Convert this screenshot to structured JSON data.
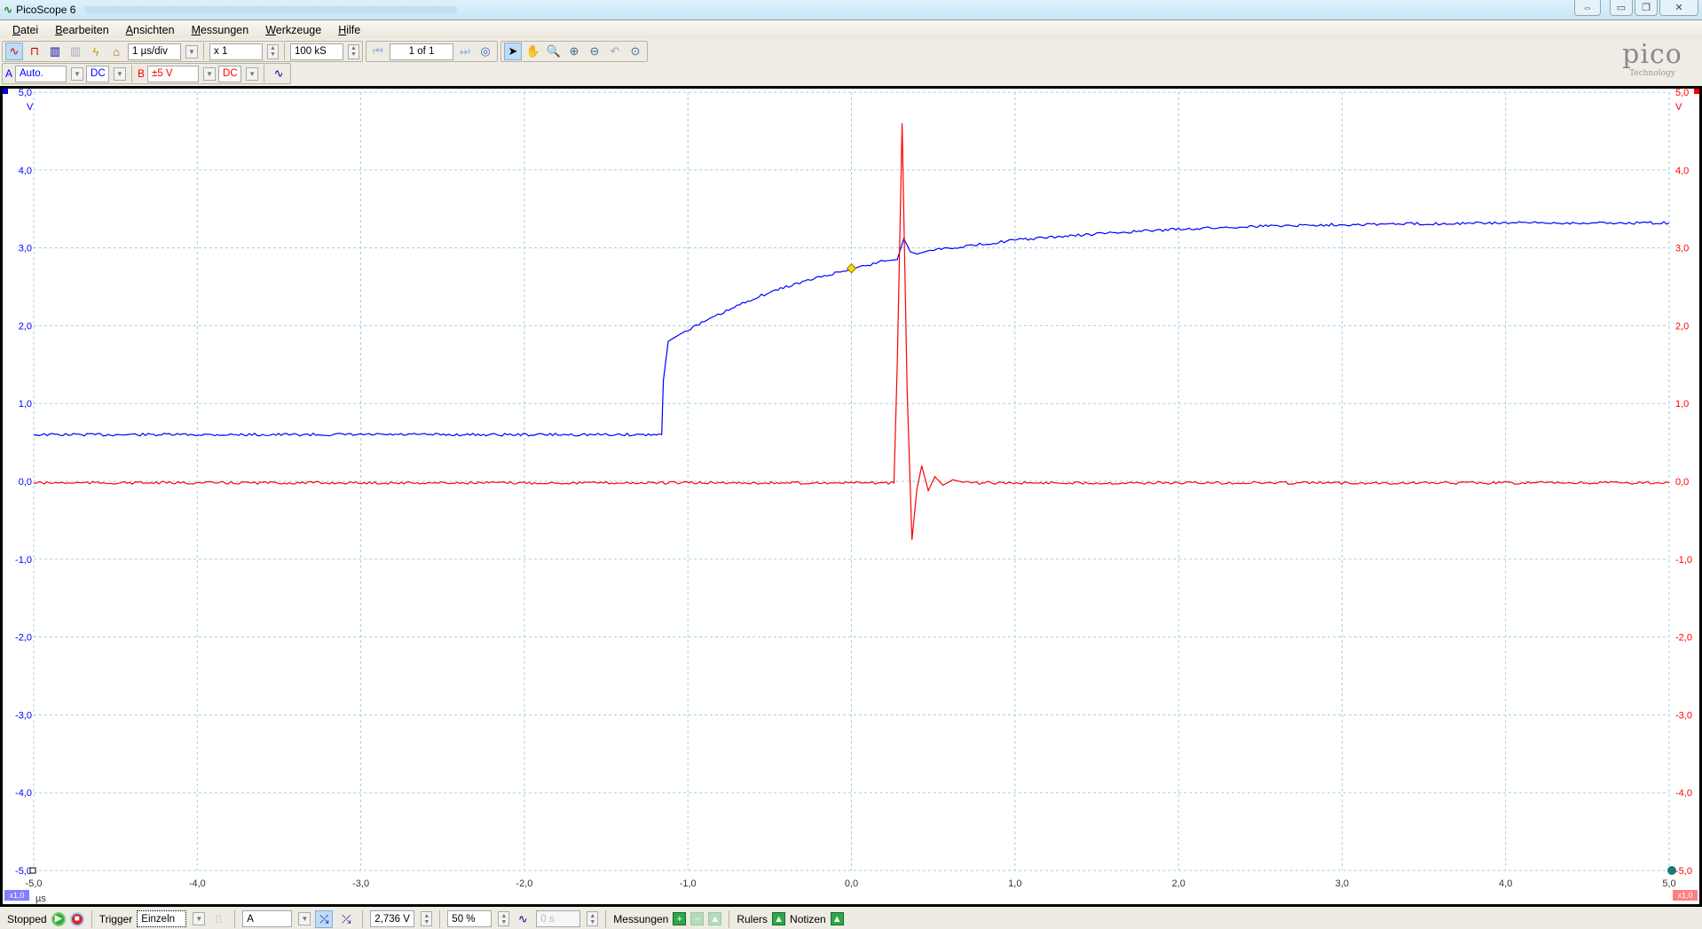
{
  "window": {
    "title": "PicoScope 6",
    "buttons": [
      "⇔",
      "▭",
      "❐",
      "✕"
    ]
  },
  "menu": [
    "Datei",
    "Bearbeiten",
    "Ansichten",
    "Messungen",
    "Werkzeuge",
    "Hilfe"
  ],
  "toolbar": {
    "timebase": "1 µs/div",
    "zoom_factor": "x 1",
    "samples": "100 kS",
    "buffer": "1 of 1"
  },
  "channels": {
    "a_label": "A",
    "a_range": "Auto.",
    "a_coupling": "DC",
    "b_label": "B",
    "b_range": "±5 V",
    "b_coupling": "DC"
  },
  "logo": {
    "name": "pico",
    "sub": "Technology"
  },
  "status": {
    "state": "Stopped",
    "trigger_label": "Trigger",
    "trigger_mode": "Einzeln",
    "trigger_source": "A",
    "threshold": "2,736 V",
    "pretrigger": "50 %",
    "delay": "0 s",
    "measurements": "Messungen",
    "rulers": "Rulers",
    "notes": "Notizen"
  },
  "chart_data": {
    "type": "line",
    "xlabel": "µs",
    "ylabel_left": "V",
    "ylabel_right": "V",
    "xlim": [
      -5,
      5
    ],
    "ylim": [
      -5,
      5
    ],
    "x_ticks": [
      "-5,0",
      "-4,0",
      "-3,0",
      "-2,0",
      "-1,0",
      "0,0",
      "1,0",
      "2,0",
      "3,0",
      "4,0",
      "5,0"
    ],
    "y_ticks": [
      "5,0",
      "4,0",
      "3,0",
      "2,0",
      "1,0",
      "0,0",
      "-1,0",
      "-2,0",
      "-3,0",
      "-4,0",
      "-5,0"
    ],
    "scale_badge_a": "x1,0",
    "scale_badge_b": "x1,0",
    "grid": true,
    "trigger_point": {
      "x": 0,
      "y": 2.736
    },
    "series": [
      {
        "name": "A",
        "color": "#0000ff",
        "x": [
          -5,
          -1.16,
          -1.15,
          -1.12,
          -1.0,
          -0.8,
          -0.6,
          -0.4,
          -0.2,
          0.0,
          0.2,
          0.28,
          0.32,
          0.36,
          0.4,
          0.5,
          0.7,
          1.0,
          1.5,
          2.0,
          2.5,
          3.0,
          4.0,
          5.0
        ],
        "y": [
          0.6,
          0.6,
          1.3,
          1.8,
          1.95,
          2.15,
          2.35,
          2.5,
          2.62,
          2.73,
          2.83,
          2.85,
          3.12,
          2.95,
          2.92,
          2.98,
          3.02,
          3.1,
          3.18,
          3.24,
          3.28,
          3.3,
          3.32,
          3.32
        ]
      },
      {
        "name": "B",
        "color": "#ff0000",
        "x": [
          -5,
          0.26,
          0.28,
          0.31,
          0.34,
          0.37,
          0.4,
          0.43,
          0.47,
          0.51,
          0.56,
          0.62,
          0.7,
          5.0
        ],
        "y": [
          -0.02,
          -0.02,
          1.5,
          4.6,
          1.2,
          -0.75,
          -0.1,
          0.2,
          -0.12,
          0.06,
          -0.05,
          0.02,
          -0.02,
          -0.02
        ]
      }
    ]
  }
}
